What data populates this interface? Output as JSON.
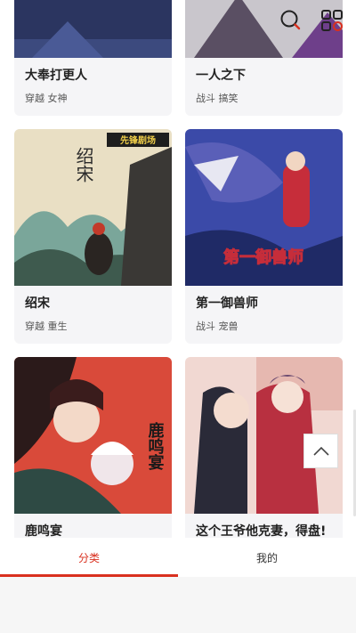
{
  "toolbar": {
    "search_icon": "search-icon",
    "menu_icon": "grid-menu-icon",
    "accent": "#d9301f"
  },
  "comics": [
    {
      "title": "大奉打更人",
      "tags": "穿越 女神"
    },
    {
      "title": "一人之下",
      "tags": "战斗 搞笑"
    },
    {
      "title": "绍宋",
      "tags": "穿越 重生",
      "cover_text": "绍宋",
      "cover_badge": "先锋剧场"
    },
    {
      "title": "第一御兽师",
      "tags": "战斗 宠兽",
      "cover_text": "第一御兽师"
    },
    {
      "title": "鹿鸣宴",
      "tags": "",
      "cover_text": "鹿鸣宴"
    },
    {
      "title": "这个王爷他克妻，得盘!",
      "tags": ""
    }
  ],
  "tabs": [
    {
      "label": "分类",
      "active": true
    },
    {
      "label": "我的",
      "active": false
    }
  ],
  "scroll_top_icon": "chevron-up-icon"
}
